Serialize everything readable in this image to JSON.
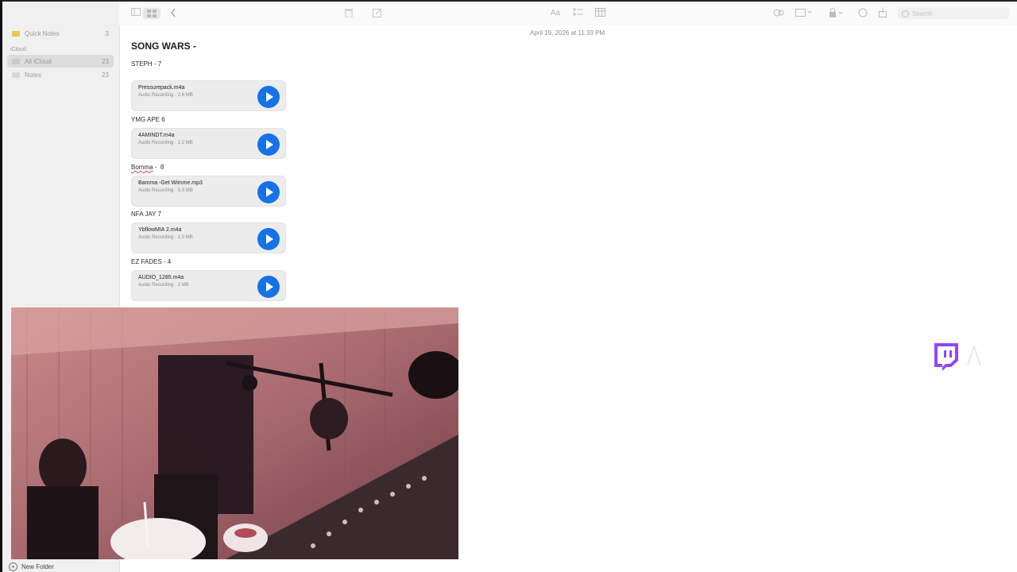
{
  "sidebar": {
    "items": [
      {
        "label": "Quick Notes",
        "count": "3"
      },
      {
        "label": "All iCloud",
        "count": "23"
      },
      {
        "label": "Notes",
        "count": "23"
      }
    ],
    "section": "iCloud",
    "new_folder_label": "New Folder"
  },
  "toolbar": {
    "search_placeholder": "Search",
    "font_label": "Aa"
  },
  "note": {
    "date": "April 19, 2026 at 11:33 PM",
    "title": "SONG WARS -",
    "sections": [
      {
        "label": "STEPH - 7",
        "file": "Pressurepack.m4a",
        "meta": "Audio Recording · 2.6 MB"
      },
      {
        "label": "YMG APE 6",
        "file": "4AMINDT.m4a",
        "meta": "Audio Recording · 2.2 MB"
      },
      {
        "label_word": "Bomma",
        "label_rest": " -  8",
        "file": "Bamma -Get Wimme.mp3",
        "meta": "Audio Recording · 5.9 MB"
      },
      {
        "label": "NFA JAY 7",
        "file": "YbflowMIA 2.m4a",
        "meta": "Audio Recording · 2.5 MB"
      },
      {
        "label": "EZ FADES - 4",
        "file": "AUDIO_1285.m4a",
        "meta": "Audio Recording · 2 MB"
      }
    ]
  },
  "colors": {
    "play_button": "#1672e6",
    "twitch": "#9146ff"
  },
  "icons": [
    "folder-icon",
    "sidebar-toggle-icon",
    "grid-view-icon",
    "back-chevron-icon",
    "trash-icon",
    "compose-icon",
    "checklist-icon",
    "table-icon",
    "share-icon",
    "lock-icon",
    "search-icon",
    "play-icon",
    "twitch-icon"
  ]
}
